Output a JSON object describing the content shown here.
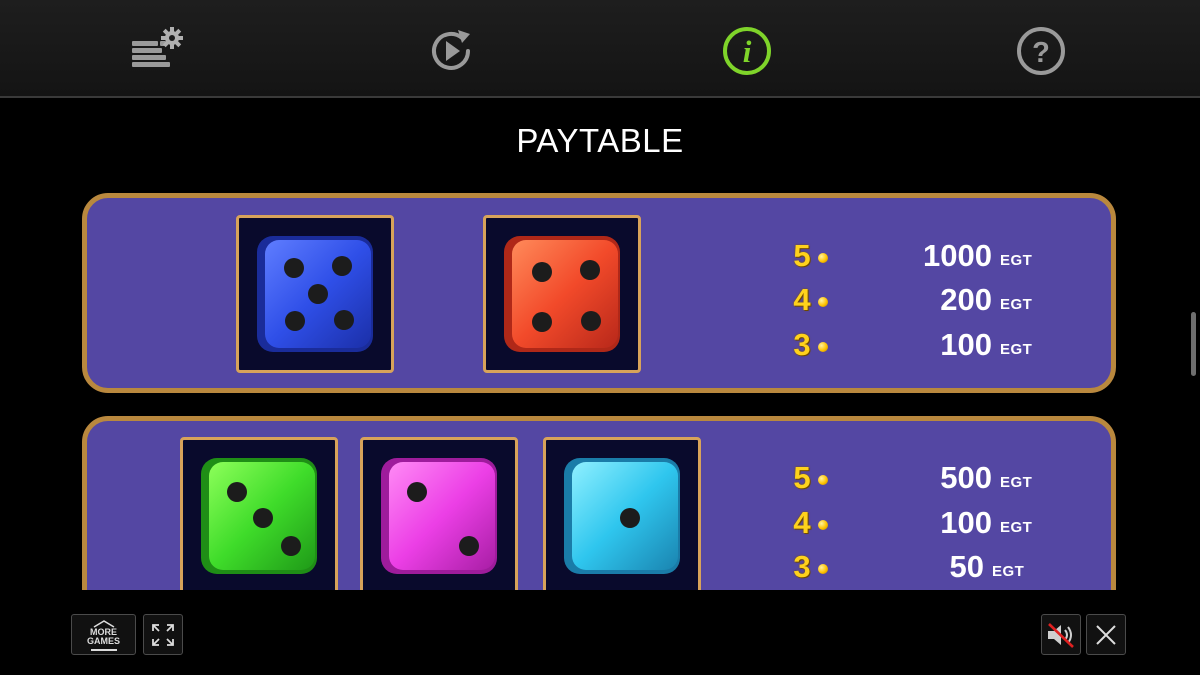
{
  "toolbar": {
    "buttons": [
      {
        "name": "bet-settings",
        "icon": "coin-stack-gear-icon"
      },
      {
        "name": "autoplay",
        "icon": "replay-play-icon"
      },
      {
        "name": "info",
        "icon": "info-icon",
        "active": true
      },
      {
        "name": "help",
        "icon": "question-icon"
      }
    ]
  },
  "title": "PAYTABLE",
  "paytable": [
    {
      "symbols": [
        {
          "color": "blue",
          "pips": 5,
          "hex": "#2f4fe8"
        },
        {
          "color": "red",
          "pips": 4,
          "hex": "#f24a2a"
        }
      ],
      "payouts": [
        {
          "count": "5",
          "amount": "1000",
          "currency": "EGT"
        },
        {
          "count": "4",
          "amount": "200",
          "currency": "EGT"
        },
        {
          "count": "3",
          "amount": "100",
          "currency": "EGT"
        }
      ]
    },
    {
      "symbols": [
        {
          "color": "green",
          "pips": 3,
          "hex": "#3fdc2a"
        },
        {
          "color": "pink",
          "pips": 2,
          "hex": "#ec3fe6"
        },
        {
          "color": "cyan",
          "pips": 1,
          "hex": "#2fc6ee"
        }
      ],
      "payouts": [
        {
          "count": "5",
          "amount": "500",
          "currency": "EGT"
        },
        {
          "count": "4",
          "amount": "100",
          "currency": "EGT"
        },
        {
          "count": "3",
          "amount": "50",
          "currency": "EGT"
        }
      ]
    }
  ],
  "bottom": {
    "more_games_line1": "MORE",
    "more_games_line2": "GAMES"
  },
  "colors": {
    "panel_bg": "#5447a3",
    "panel_border": "#b9883e",
    "accent_green": "#7fd42a",
    "count_yellow": "#ffd21c"
  }
}
